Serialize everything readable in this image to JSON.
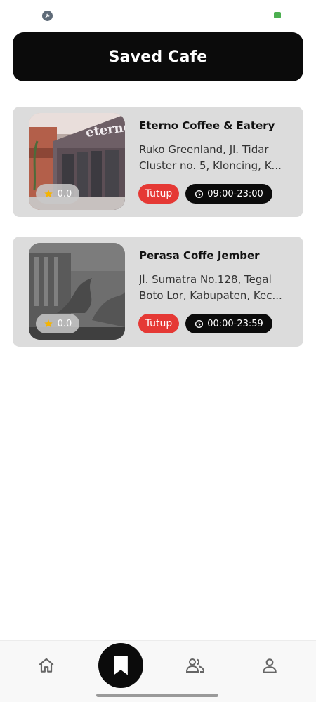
{
  "header": {
    "title": "Saved Cafe"
  },
  "cafes": [
    {
      "name": "Eterno Coffee & Eatery",
      "address": "Ruko Greenland, Jl. Tidar Cluster no. 5, Kloncing, K...",
      "rating": "0.0",
      "status": "Tutup",
      "hours": "09:00-23:00",
      "sign_text": "eterno"
    },
    {
      "name": "Perasa Coffe Jember",
      "address": "Jl. Sumatra No.128, Tegal Boto Lor, Kabupaten, Kec...",
      "rating": "0.0",
      "status": "Tutup",
      "hours": "00:00-23:59"
    }
  ],
  "colors": {
    "header_bg": "#0b0b0b",
    "card_bg": "#dcdcdc",
    "closed_badge": "#e53935",
    "hours_badge": "#0b0b0b",
    "star": "#f5b400"
  },
  "icons": {
    "status_left": "settings-icon",
    "status_right": "battery-icon",
    "rating": "star-icon",
    "hours": "clock-icon",
    "nav": [
      "home-icon",
      "bookmark-icon",
      "community-icon",
      "profile-icon"
    ]
  }
}
